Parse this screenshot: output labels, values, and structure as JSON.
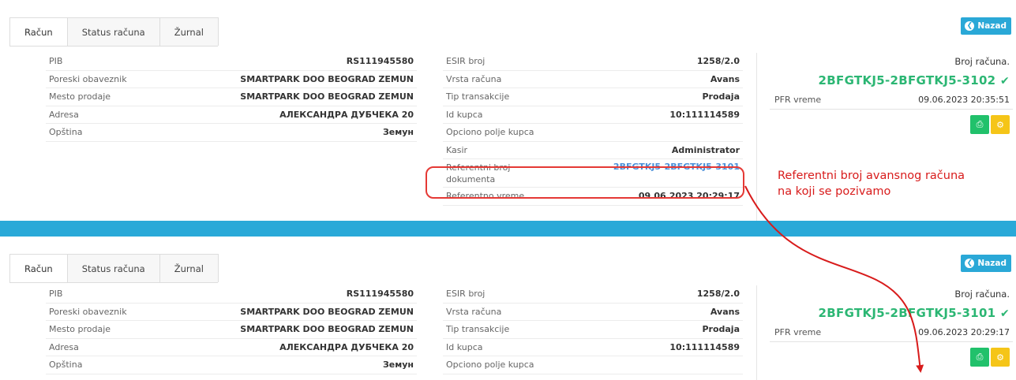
{
  "tabs": [
    "Račun",
    "Status računa",
    "Žurnal"
  ],
  "back_label": "Nazad",
  "top": {
    "left": [
      {
        "label": "PIB",
        "value": "RS111945580"
      },
      {
        "label": "Poreski obaveznik",
        "value": "SMARTPARK DOO BEOGRAD ZEMUN"
      },
      {
        "label": "Mesto prodaje",
        "value": "SMARTPARK DOO BEOGRAD ZEMUN"
      },
      {
        "label": "Adresa",
        "value": "АЛЕКСАНДРА ДУБЧЕКА 20"
      },
      {
        "label": "Opština",
        "value": "Земун"
      }
    ],
    "middle": [
      {
        "label": "ESIR broj",
        "value": "1258/2.0"
      },
      {
        "label": "Vrsta računa",
        "value": "Avans"
      },
      {
        "label": "Tip transakcije",
        "value": "Prodaja"
      },
      {
        "label": "Id kupca",
        "value": "10:111114589"
      },
      {
        "label": "Opciono polje kupca",
        "value": ""
      },
      {
        "label": "Kasir",
        "value": "Administrator"
      },
      {
        "label": "Referentni broj dokumenta",
        "value": "2BFGTKJ5-2BFGTKJ5-3101"
      },
      {
        "label": "Referentno vreme",
        "value": "09.06.2023 20:29:17"
      }
    ],
    "broj_title": "Broj računa.",
    "broj_number": "2BFGTKJ5-2BFGTKJ5-3102",
    "pfr_label": "PFR vreme",
    "pfr_value": "09.06.2023 20:35:51"
  },
  "bottom": {
    "left": [
      {
        "label": "PIB",
        "value": "RS111945580"
      },
      {
        "label": "Poreski obaveznik",
        "value": "SMARTPARK DOO BEOGRAD ZEMUN"
      },
      {
        "label": "Mesto prodaje",
        "value": "SMARTPARK DOO BEOGRAD ZEMUN"
      },
      {
        "label": "Adresa",
        "value": "АЛЕКСАНДРА ДУБЧЕКА 20"
      },
      {
        "label": "Opština",
        "value": "Земун"
      }
    ],
    "middle": [
      {
        "label": "ESIR broj",
        "value": "1258/2.0"
      },
      {
        "label": "Vrsta računa",
        "value": "Avans"
      },
      {
        "label": "Tip transakcije",
        "value": "Prodaja"
      },
      {
        "label": "Id kupca",
        "value": "10:111114589"
      },
      {
        "label": "Opciono polje kupca",
        "value": ""
      }
    ],
    "broj_title": "Broj računa.",
    "broj_number": "2BFGTKJ5-2BFGTKJ5-3101",
    "pfr_label": "PFR vreme",
    "pfr_value": "09.06.2023 20:29:17"
  },
  "annotation": {
    "line1": "Referentni broj avansnog računa",
    "line2": "na koji se pozivamo",
    "color": "#d81b1b"
  },
  "colors": {
    "accent": "#2aa8d7",
    "success": "#21c16b",
    "warning": "#f5c518",
    "link": "#4a90d9"
  },
  "icons": {
    "back": "arrow-circle-left-icon",
    "check": "check-icon",
    "print": "printer-icon",
    "extra": "gear-icon"
  }
}
